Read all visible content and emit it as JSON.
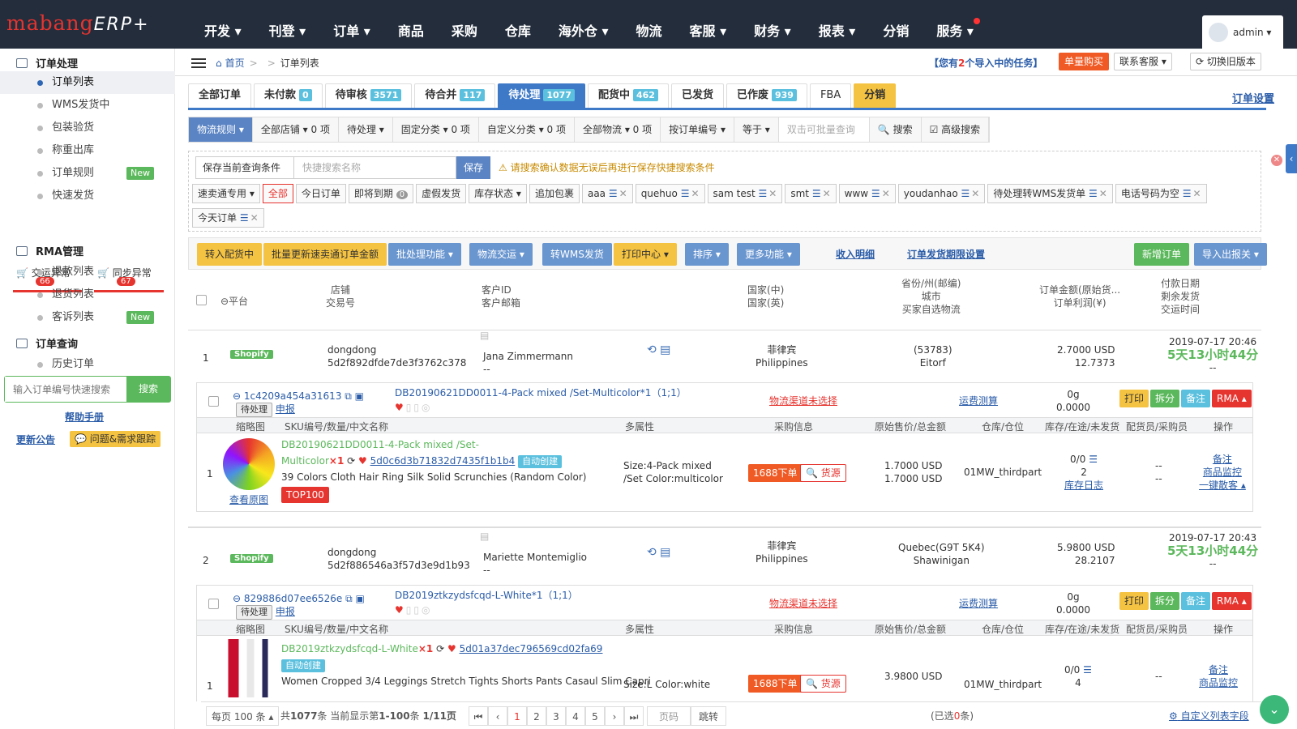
{
  "app": {
    "logo_brand": "mabang",
    "logo_product": "ERP+"
  },
  "topnav": {
    "items": [
      "开发 ▾",
      "刊登 ▾",
      "订单 ▾",
      "商品",
      "采购",
      "仓库",
      "海外仓 ▾",
      "物流",
      "客服 ▾",
      "财务 ▾",
      "报表 ▾",
      "分销",
      "服务 ▾"
    ],
    "user": "admin ▾"
  },
  "sidebar": {
    "group_order": "订单处理",
    "items": [
      "订单列表",
      "WMS发货中",
      "包装验货",
      "称重出库",
      "订单规则",
      "快速发货"
    ],
    "new_badge": "New",
    "exc1": {
      "label": "交运异常",
      "count": "66"
    },
    "exc2": {
      "label": "同步异常",
      "count": "67"
    },
    "group_rma": "RMA管理",
    "rma_items": [
      "退款列表",
      "退货列表",
      "客诉列表"
    ],
    "group_query": "订单查询",
    "query_items": [
      "历史订单"
    ],
    "quick_search_placeholder": "输入订单编号快速搜索",
    "quick_search_btn": "搜索",
    "help": "帮助手册",
    "notice": "更新公告",
    "issue": "问题&需求跟踪"
  },
  "breadcrumb": {
    "home": "首页",
    "sep": ">",
    "current": "订单列表"
  },
  "header_actions": {
    "task_pre": "【您有",
    "task_count": "2",
    "task_post": "个导入中的任务】",
    "buy": "单量购买",
    "contact": "联系客服 ▾",
    "switch": "切换旧版本"
  },
  "tabs": [
    {
      "label": "全部订单",
      "count": ""
    },
    {
      "label": "未付款",
      "count": "0"
    },
    {
      "label": "待审核",
      "count": "3571"
    },
    {
      "label": "待合并",
      "count": "117"
    },
    {
      "label": "待处理",
      "count": "1077"
    },
    {
      "label": "配货中",
      "count": "462"
    },
    {
      "label": "已发货",
      "count": ""
    },
    {
      "label": "已作废",
      "count": "939"
    },
    {
      "label": "FBA",
      "count": ""
    },
    {
      "label": "分销",
      "count": ""
    }
  ],
  "order_settings": "订单设置",
  "filters": [
    "物流规则 ▾",
    "全部店铺 ▾ 0 项",
    "待处理 ▾",
    "固定分类 ▾ 0 项",
    "自定义分类 ▾ 0 项",
    "全部物流 ▾ 0 项",
    "按订单编号 ▾",
    "等于 ▾",
    "双击可批量查询",
    "🔍 搜索",
    "☑ 高级搜索"
  ],
  "saved": {
    "label": "保存当前查询条件",
    "placeholder": "快捷搜索名称",
    "btn": "保存",
    "warning": "⚠ 请搜索确认数据无误后再进行保存快捷搜索条件"
  },
  "chips": [
    "速卖通专用 ▾",
    "全部",
    "今日订单",
    "即将到期",
    "虚假发货",
    "库存状态 ▾",
    "追加包裹",
    "aaa",
    "quehuo",
    "sam test",
    "smt",
    "www",
    "youdanhao",
    "待处理转WMS发货单",
    "电话号码为空",
    "今天订单"
  ],
  "chip_due_count": "0",
  "actions": {
    "a1": "转入配货中",
    "a2": "批量更新速卖通订单金额",
    "a3": "批处理功能 ▾",
    "a4": "物流交运 ▾",
    "a5": "转WMS发货",
    "a6": "打印中心 ▾",
    "a7": "排序 ▾",
    "a8": "更多功能 ▾",
    "l1": "收入明细",
    "l2": "订单发货期限设置",
    "add": "新增订单",
    "io": "导入出报关 ▾"
  },
  "thead": {
    "platform": "⊖平台",
    "store": "店铺",
    "trade": "交易号",
    "cust_id": "客户ID",
    "cust_mail": "客户邮箱",
    "country_cn": "国家(中)",
    "country_en": "国家(英)",
    "province": "省份/州(邮编)",
    "city": "城市",
    "buyer_ship": "买家自选物流",
    "amount": "订单金额(原始货...",
    "profit": "订单利润(¥)",
    "pay_date": "付款日期",
    "remain": "剩余发货",
    "ship_time": "交运时间"
  },
  "orders": [
    {
      "idx": "1",
      "platform": "Shopify",
      "store": "dongdong",
      "trade": "5d2f892dfde7de3f3762c378",
      "customer": "Jana Zimmermann",
      "cdash": "--",
      "country_cn": "菲律宾",
      "country_en": "Philippines",
      "province": "(53783)",
      "city": "Eitorf",
      "amount": "2.7000 USD",
      "profit": "12.7373",
      "date": "2019-07-17 20:46",
      "remain": "5天13小时44分",
      "rdash": "--",
      "sub": {
        "id": "1c4209a454a31613",
        "status": "待处理",
        "report": "申报",
        "title": "DB20190621DD0011-4-Pack mixed /Set-Multicolor*1（1;1）",
        "channel": "物流渠道未选择",
        "calc": "运费测算",
        "weight": "0g",
        "wval": "0.0000"
      },
      "item": {
        "idx": "1",
        "sku1": "DB20190621DD0011-4-Pack mixed /Set-",
        "sku2": "Multicolor",
        "qty": "×1",
        "code": "5d0c6d3b71832d7435f1b1b4",
        "auto": "自动创建",
        "name": "39 Colors Cloth Hair Ring Silk Solid Scrunchies (Random Color)",
        "top": "TOP100",
        "viewimg": "查看原图",
        "attr1": "Size:4-Pack mixed",
        "attr2": "/Set Color:multicolor",
        "p1688": "1688下单",
        "source": "🔍 货源",
        "price1": "1.7000 USD",
        "price2": "1.7000 USD",
        "wh": "01MW_thirdpart",
        "stock": "0/0",
        "stock2": "2",
        "stocklog": "库存日志",
        "dash1": "--",
        "dash2": "--",
        "op1": "备注",
        "op2": "商品监控",
        "op3": "一键散客 ▴"
      }
    },
    {
      "idx": "2",
      "platform": "Shopify",
      "store": "dongdong",
      "trade": "5d2f886546a3f57d3e9d1b93",
      "customer": "Mariette Montemiglio",
      "cdash": "--",
      "country_cn": "菲律宾",
      "country_en": "Philippines",
      "province": "Quebec(G9T 5K4)",
      "city": "Shawinigan",
      "amount": "5.9800 USD",
      "profit": "28.2107",
      "date": "2019-07-17 20:43",
      "remain": "5天13小时44分",
      "rdash": "--",
      "sub": {
        "id": "829886d07ee6526e",
        "status": "待处理",
        "report": "申报",
        "title": "DB2019ztkzydsfcqd-L-White*1（1;1）",
        "channel": "物流渠道未选择",
        "calc": "运费测算",
        "weight": "0g",
        "wval": "0.0000"
      },
      "item": {
        "idx": "1",
        "sku1": "DB2019ztkzydsfcqd-L-White",
        "qty": "×1",
        "code": "5d01a37dec796569cd02fa69",
        "auto": "自动创建",
        "name": "Women Cropped 3/4 Leggings Stretch Tights Shorts Pants Casaul Slim Capri",
        "attr1": "Size:L Color:white",
        "p1688": "1688下单",
        "source": "🔍 货源",
        "price1": "3.9800 USD",
        "wh": "01MW_thirdpart",
        "stock": "0/0",
        "stock2": "4",
        "dash1": "--",
        "op1": "备注",
        "op2": "商品监控"
      }
    }
  ],
  "item_head": {
    "thumb": "缩略图",
    "sku": "SKU编号/数量/中文名称",
    "attr": "多属性",
    "purchase": "采购信息",
    "price": "原始售价/总金额",
    "wh": "仓库/仓位",
    "stock": "库存/在途/未发货",
    "staff": "配货员/采购员",
    "op": "操作"
  },
  "sub_btns": {
    "print": "打印",
    "split": "拆分",
    "note": "备注",
    "rma": "RMA ▴"
  },
  "footer": {
    "per_page": "每页 100 条 ▴",
    "total_pre": "共",
    "total": "1077",
    "total_post": "条 当前显示第",
    "range": "1-100",
    "range_post": "条",
    "pages": "1/11页",
    "page_nums": [
      "1",
      "2",
      "3",
      "4",
      "5"
    ],
    "page_input": "页码",
    "jump": "跳转",
    "selected_pre": "(已选",
    "selected": "0",
    "selected_post": "条)",
    "custom": "自定义列表字段"
  }
}
